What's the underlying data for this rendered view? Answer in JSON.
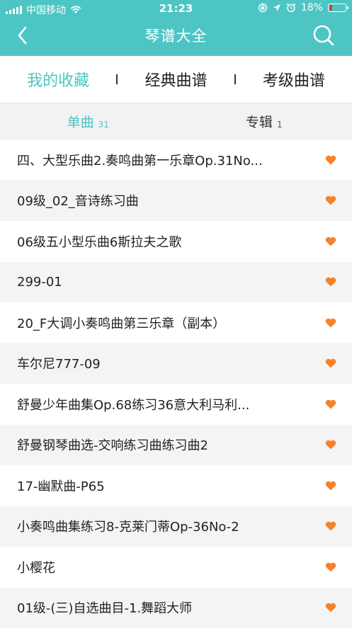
{
  "status_bar": {
    "carrier": "中国移动",
    "time": "21:23",
    "battery": "18%",
    "battery_level": 0.18,
    "colors": {
      "battery_low": "#e63a3a"
    }
  },
  "header": {
    "title": "琴谱大全",
    "bg_color": "#4dc5c4",
    "icons": {
      "back": "chevron-left-icon",
      "search": "search-icon"
    }
  },
  "categories": [
    {
      "label": "我的收藏",
      "active": true
    },
    {
      "label": "经典曲谱",
      "active": false
    },
    {
      "label": "考级曲谱",
      "active": false
    }
  ],
  "subtabs": [
    {
      "label": "单曲",
      "count": "31",
      "active": true
    },
    {
      "label": "专辑",
      "count": "1",
      "active": false
    }
  ],
  "songs": [
    "四、大型乐曲2.奏鸣曲第一乐章Op.31No...",
    "09级_02_音诗练习曲",
    "06级五小型乐曲6斯拉夫之歌",
    "299-01",
    "20_F大调小奏鸣曲第三乐章（副本）",
    "车尔尼777-09",
    "舒曼少年曲集Op.68练习36意大利马利...",
    "舒曼钢琴曲选-交响练习曲练习曲2",
    "17-幽默曲-P65",
    "小奏鸣曲集练习8-克莱门蒂Op-36No-2",
    "小樱花",
    "01级-(三)自选曲目-1.舞蹈大师"
  ],
  "colors": {
    "accent": "#4dc5c4",
    "heart": "#f5822a"
  }
}
